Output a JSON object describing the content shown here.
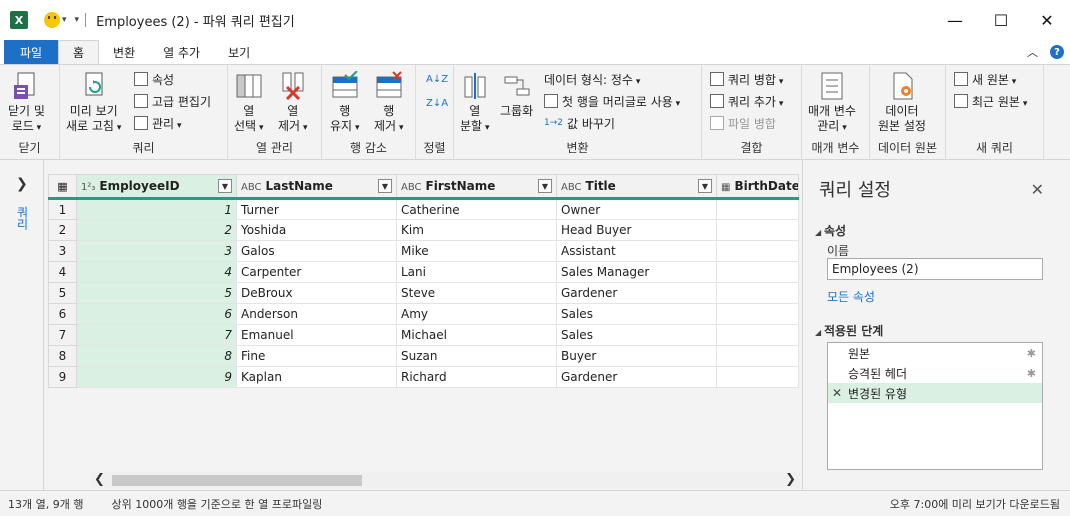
{
  "titlebar": {
    "app_icon": "X",
    "title": "Employees (2) - 파워 쿼리 편집기",
    "minimize": "—",
    "maximize": "☐",
    "close": "✕"
  },
  "menu": {
    "tabs": [
      "파일",
      "홈",
      "변환",
      "열 추가",
      "보기"
    ],
    "active": "홈"
  },
  "ribbon": {
    "close_group": {
      "label": "닫기",
      "btn_line1": "닫기 및",
      "btn_line2": "로드"
    },
    "query_group": {
      "label": "쿼리",
      "refresh_line1": "미리 보기",
      "refresh_line2": "새로 고침",
      "properties": "속성",
      "advanced_editor": "고급 편집기",
      "manage": "관리"
    },
    "columns_group": {
      "label": "열 관리",
      "choose_line1": "열",
      "choose_line2": "선택",
      "remove_line1": "열",
      "remove_line2": "제거"
    },
    "rows_group": {
      "label": "행 감소",
      "keep_line1": "행",
      "keep_line2": "유지",
      "remove_line1": "행",
      "remove_line2": "제거"
    },
    "sort_group": {
      "label": "정렬"
    },
    "transform_group": {
      "label": "변환",
      "split_line1": "열",
      "split_line2": "분할",
      "group_by": "그룹화",
      "data_type": "데이터 형식: 정수",
      "first_row_header": "첫 행을 머리글로 사용",
      "replace_values": "값 바꾸기"
    },
    "combine_group": {
      "label": "결합",
      "merge": "쿼리 병합",
      "append": "쿼리 추가",
      "combine_files": "파일 병합"
    },
    "params_group": {
      "label": "매개 변수",
      "btn_line1": "매개 변수",
      "btn_line2": "관리"
    },
    "source_group": {
      "label": "데이터 원본",
      "btn_line1": "데이터",
      "btn_line2": "원본 설정"
    },
    "newquery_group": {
      "label": "새 쿼리",
      "new_source": "새 원본",
      "recent_source": "최근 원본"
    }
  },
  "nav": {
    "label": "쿼리"
  },
  "grid": {
    "columns": [
      {
        "type": "1²₃",
        "name": "EmployeeID"
      },
      {
        "type": "ABC",
        "name": "LastName"
      },
      {
        "type": "ABC",
        "name": "FirstName"
      },
      {
        "type": "ABC",
        "name": "Title"
      },
      {
        "type": "▦",
        "name": "BirthDate"
      }
    ],
    "rows": [
      [
        "1",
        "1",
        "Turner",
        "Catherine",
        "Owner",
        ""
      ],
      [
        "2",
        "2",
        "Yoshida",
        "Kim",
        "Head Buyer",
        ""
      ],
      [
        "3",
        "3",
        "Galos",
        "Mike",
        "Assistant",
        ""
      ],
      [
        "4",
        "4",
        "Carpenter",
        "Lani",
        "Sales Manager",
        ""
      ],
      [
        "5",
        "5",
        "DeBroux",
        "Steve",
        "Gardener",
        ""
      ],
      [
        "6",
        "6",
        "Anderson",
        "Amy",
        "Sales",
        ""
      ],
      [
        "7",
        "7",
        "Emanuel",
        "Michael",
        "Sales",
        ""
      ],
      [
        "8",
        "8",
        "Fine",
        "Suzan",
        "Buyer",
        ""
      ],
      [
        "9",
        "9",
        "Kaplan",
        "Richard",
        "Gardener",
        ""
      ]
    ]
  },
  "settings": {
    "title": "쿼리 설정",
    "properties_header": "속성",
    "name_label": "이름",
    "name_value": "Employees (2)",
    "all_properties": "모든 속성",
    "steps_header": "적용된 단계",
    "steps": [
      "원본",
      "승격된 헤더",
      "변경된 유형"
    ]
  },
  "status": {
    "left": "13개 열, 9개 행",
    "mid": "상위 1000개 행을 기준으로 한 열 프로파일링",
    "right": "오후 7:00에 미리 보기가 다운로드됨"
  },
  "colors": {
    "accent": "#1e70c7",
    "selected_column": "#d9f0e2",
    "header_underline": "#1aa085",
    "excel_green": "#1e7145"
  }
}
